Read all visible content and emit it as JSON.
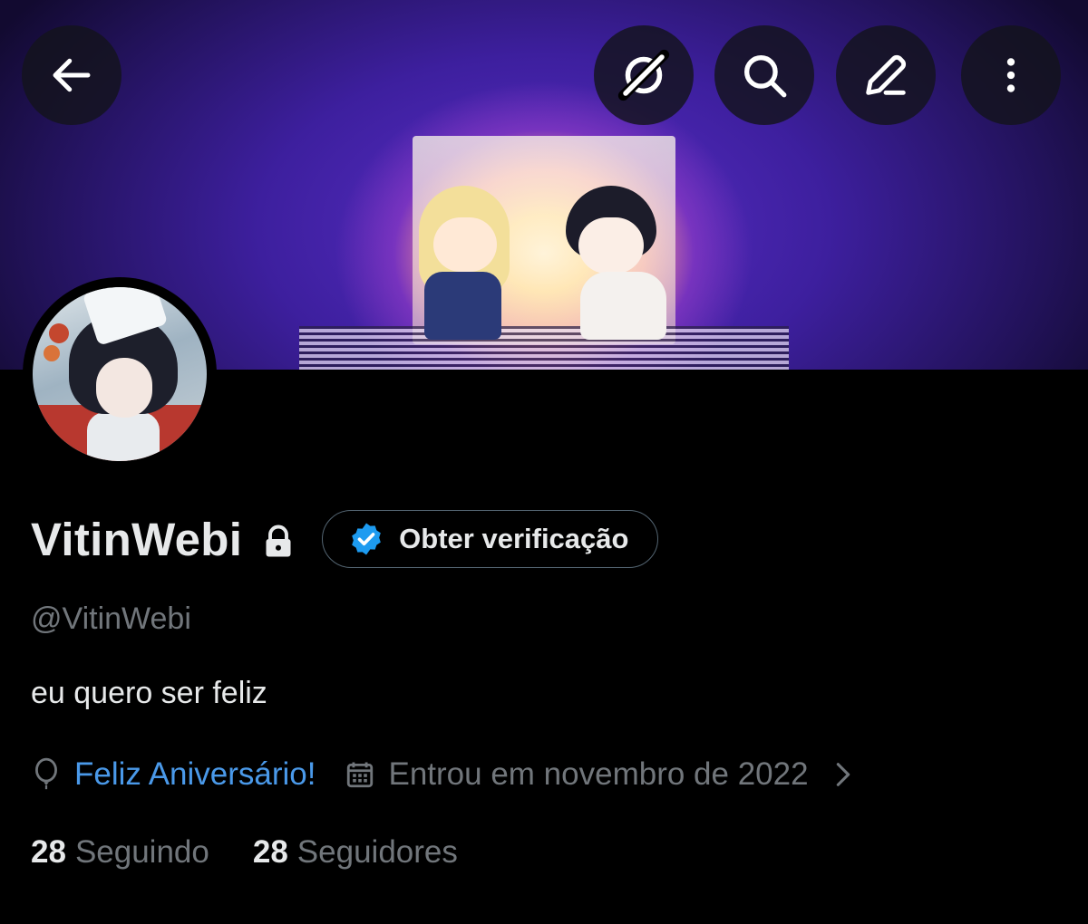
{
  "profile": {
    "display_name": "VitinWebi",
    "handle": "@VitinWebi",
    "bio": "eu quero ser feliz",
    "birthday_text": "Feliz Aniversário!",
    "joined_text": "Entrou em novembro de 2022"
  },
  "verify_button": {
    "label": "Obter verificação"
  },
  "stats": {
    "following_count": "28",
    "following_label": "Seguindo",
    "followers_count": "28",
    "followers_label": "Seguidores"
  },
  "icons": {
    "back": "arrow-left-icon",
    "grok": "grok-icon",
    "search": "search-icon",
    "edit": "edit-icon",
    "more": "more-vertical-icon",
    "lock": "lock-icon",
    "verified": "verified-badge-icon",
    "balloon": "balloon-icon",
    "calendar": "calendar-icon",
    "chevron": "chevron-right-icon"
  },
  "colors": {
    "background": "#000000",
    "text_primary": "#e7e9ea",
    "text_secondary": "#71767b",
    "link_blue": "#4a99e9",
    "verified_blue": "#1d9bf0"
  }
}
